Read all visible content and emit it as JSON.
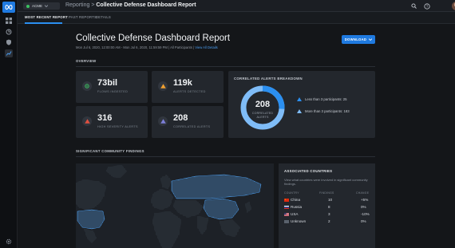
{
  "topbar": {
    "org_label": "ACME",
    "breadcrumb_parent": "Reporting",
    "breadcrumb_sep": ">",
    "breadcrumb_current": "Collective Defense Dashboard Report"
  },
  "tabs": [
    {
      "label": "MOST RECENT REPORT"
    },
    {
      "label": "PAST REPORTS"
    },
    {
      "label": "DETAILS"
    }
  ],
  "header": {
    "title": "Collective Defense Dashboard Report",
    "date_range": "Mon Jul 6, 2020, 12:00:00 AM - Mon Jul 6, 2020, 11:59:59 PM | All Participants |",
    "view_all_link": "View All Details",
    "download_label": "DOWNLOAD"
  },
  "overview": {
    "label": "OVERVIEW",
    "stats": [
      {
        "value": "73bil",
        "label": "FLOWS INGESTED",
        "icon": "flows-icon",
        "color": "#3cc261"
      },
      {
        "value": "119k",
        "label": "ALERTS DETECTED",
        "icon": "warning-icon",
        "color": "#f0a030"
      },
      {
        "value": "316",
        "label": "HIGH SEVERITY ALERTS",
        "icon": "high-severity-icon",
        "color": "#e05040"
      },
      {
        "value": "208",
        "label": "CORRELATED ALERTS",
        "icon": "correlated-icon",
        "color": "#7d7fd8"
      }
    ]
  },
  "correlated": {
    "title": "CORRELATED ALERTS BREAKDOWN",
    "total": "208",
    "total_label_1": "CORRELATED",
    "total_label_2": "ALERTS",
    "ring_primary_fraction": 0.26,
    "legend": [
      {
        "label": "Less than 3 participants: 25",
        "color": "#2b8ff0"
      },
      {
        "label": "More than 3 participants: 183",
        "color": "#7fbcf7"
      }
    ]
  },
  "findings": {
    "label": "SIGNIFICANT COMMUNITY FINDINGS"
  },
  "countries": {
    "title": "ASSOCIATED COUNTRIES",
    "description": "View what countries were involved in significant community findings.",
    "columns": [
      "COUNTRY",
      "FINDINGS",
      "CHANGE"
    ],
    "rows": [
      {
        "name": "China",
        "findings": "10",
        "change": "+5%"
      },
      {
        "name": "Russia",
        "findings": "8",
        "change": "0%"
      },
      {
        "name": "USA",
        "findings": "3",
        "change": "-10%"
      },
      {
        "name": "Unknown",
        "findings": "2",
        "change": "0%"
      }
    ]
  },
  "colors": {
    "accent": "#1f7ae0",
    "highlight_region": "#3f86c9",
    "map_base": "#3a4350"
  }
}
